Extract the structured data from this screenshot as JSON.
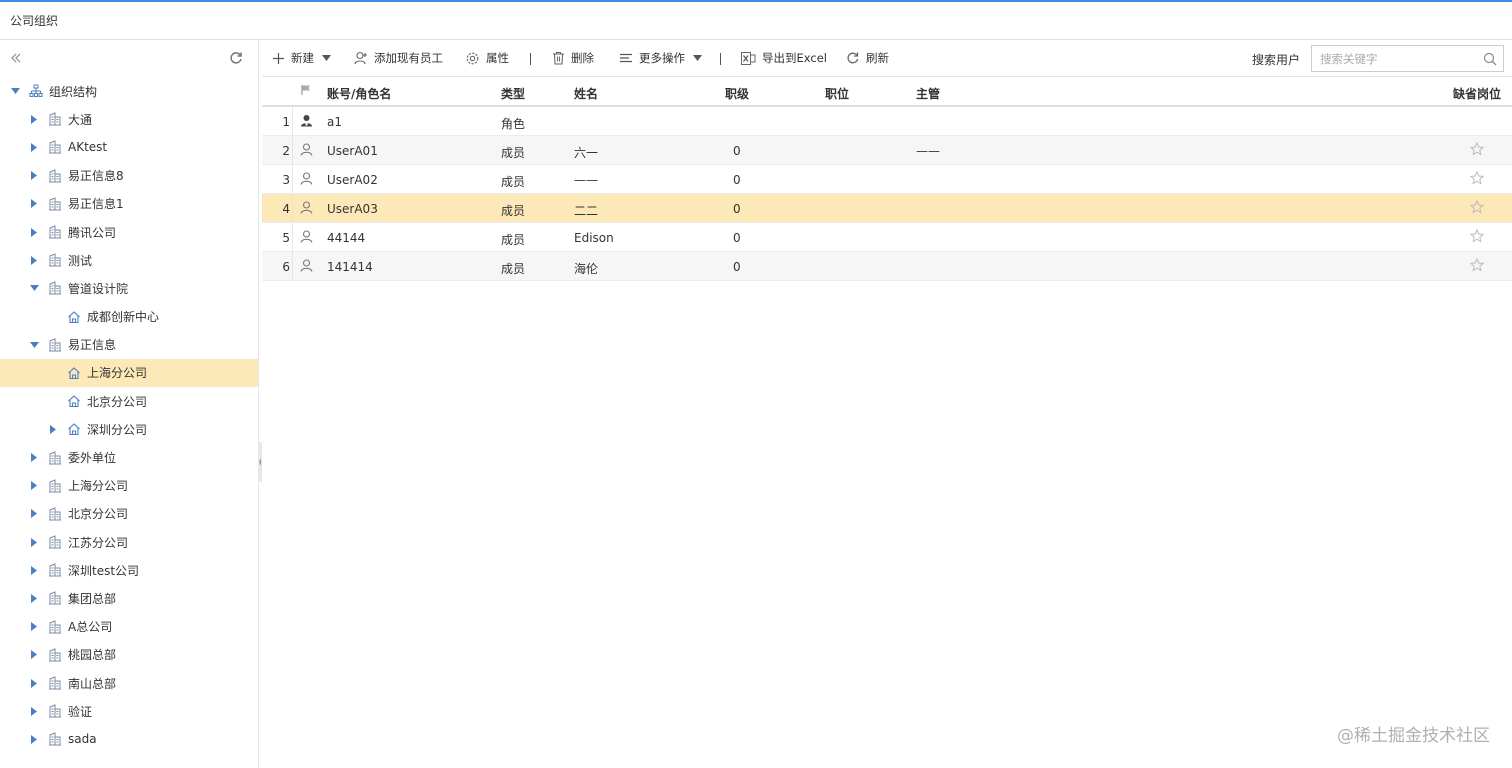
{
  "window": {
    "title": "公司组织"
  },
  "sidebar": {
    "collapse_icon": "double-chevron-left-icon",
    "refresh_icon": "refresh-icon",
    "tree": [
      {
        "label": "组织结构",
        "level": 0,
        "expanded": true,
        "icon": "org-chart-icon",
        "has_children": true
      },
      {
        "label": "大通",
        "level": 1,
        "expanded": false,
        "icon": "building-icon",
        "has_children": true
      },
      {
        "label": "AKtest",
        "level": 1,
        "expanded": false,
        "icon": "building-icon",
        "has_children": true
      },
      {
        "label": "易正信息8",
        "level": 1,
        "expanded": false,
        "icon": "building-icon",
        "has_children": true
      },
      {
        "label": "易正信息1",
        "level": 1,
        "expanded": false,
        "icon": "building-icon",
        "has_children": true
      },
      {
        "label": "腾讯公司",
        "level": 1,
        "expanded": false,
        "icon": "building-icon",
        "has_children": true
      },
      {
        "label": "测试",
        "level": 1,
        "expanded": false,
        "icon": "building-icon",
        "has_children": true
      },
      {
        "label": "管道设计院",
        "level": 1,
        "expanded": true,
        "icon": "building-icon",
        "has_children": true
      },
      {
        "label": "成都创新中心",
        "level": 2,
        "expanded": false,
        "icon": "home-icon",
        "has_children": false
      },
      {
        "label": "易正信息",
        "level": 1,
        "expanded": true,
        "icon": "building-icon",
        "has_children": true
      },
      {
        "label": "上海分公司",
        "level": 2,
        "expanded": false,
        "icon": "home-icon",
        "has_children": false,
        "selected": true
      },
      {
        "label": "北京分公司",
        "level": 2,
        "expanded": false,
        "icon": "home-icon",
        "has_children": false
      },
      {
        "label": "深圳分公司",
        "level": 2,
        "expanded": false,
        "icon": "home-icon",
        "has_children": true
      },
      {
        "label": "委外单位",
        "level": 1,
        "expanded": false,
        "icon": "building-icon",
        "has_children": true
      },
      {
        "label": "上海分公司",
        "level": 1,
        "expanded": false,
        "icon": "building-icon",
        "has_children": true
      },
      {
        "label": "北京分公司",
        "level": 1,
        "expanded": false,
        "icon": "building-icon",
        "has_children": true
      },
      {
        "label": "江苏分公司",
        "level": 1,
        "expanded": false,
        "icon": "building-icon",
        "has_children": true
      },
      {
        "label": "深圳test公司",
        "level": 1,
        "expanded": false,
        "icon": "building-icon",
        "has_children": true
      },
      {
        "label": "集团总部",
        "level": 1,
        "expanded": false,
        "icon": "building-icon",
        "has_children": true
      },
      {
        "label": "A总公司",
        "level": 1,
        "expanded": false,
        "icon": "building-icon",
        "has_children": true
      },
      {
        "label": "桃园总部",
        "level": 1,
        "expanded": false,
        "icon": "building-icon",
        "has_children": true
      },
      {
        "label": "南山总部",
        "level": 1,
        "expanded": false,
        "icon": "building-icon",
        "has_children": true
      },
      {
        "label": "验证",
        "level": 1,
        "expanded": false,
        "icon": "building-icon",
        "has_children": true
      },
      {
        "label": "sada",
        "level": 1,
        "expanded": false,
        "icon": "building-icon",
        "has_children": true
      }
    ]
  },
  "toolbar": {
    "new_label": "新建",
    "add_existing_label": "添加现有员工",
    "properties_label": "属性",
    "delete_label": "删除",
    "more_label": "更多操作",
    "export_label": "导出到Excel",
    "refresh_label": "刷新",
    "search_label": "搜索用户",
    "search_placeholder": "搜索关键字"
  },
  "grid": {
    "columns": {
      "account": "账号/角色名",
      "type": "类型",
      "name": "姓名",
      "grade": "职级",
      "position": "职位",
      "supervisor": "主管",
      "default_post": "缺省岗位"
    },
    "rows": [
      {
        "num": "1",
        "account": "a1",
        "type": "角色",
        "name": "",
        "grade": "",
        "position": "",
        "supervisor": "",
        "icon": "role-icon",
        "star": false
      },
      {
        "num": "2",
        "account": "UserA01",
        "type": "成员",
        "name": "六一",
        "grade": "0",
        "position": "",
        "supervisor": "——",
        "icon": "user-icon",
        "star": true
      },
      {
        "num": "3",
        "account": "UserA02",
        "type": "成员",
        "name": "——",
        "grade": "0",
        "position": "",
        "supervisor": "",
        "icon": "user-icon",
        "star": true
      },
      {
        "num": "4",
        "account": "UserA03",
        "type": "成员",
        "name": "二二",
        "grade": "0",
        "position": "",
        "supervisor": "",
        "icon": "user-icon",
        "star": true,
        "selected": true
      },
      {
        "num": "5",
        "account": "44144",
        "type": "成员",
        "name": "Edison",
        "grade": "0",
        "position": "",
        "supervisor": "",
        "icon": "user-icon",
        "star": true
      },
      {
        "num": "6",
        "account": "141414",
        "type": "成员",
        "name": "海伦",
        "grade": "0",
        "position": "",
        "supervisor": "",
        "icon": "user-icon",
        "star": true
      }
    ]
  },
  "watermark": "@稀土掘金技术社区",
  "colors": {
    "selected": "#fde9b8",
    "accent": "#3a8ee6",
    "tree_arrow": "#4a7fc1"
  }
}
